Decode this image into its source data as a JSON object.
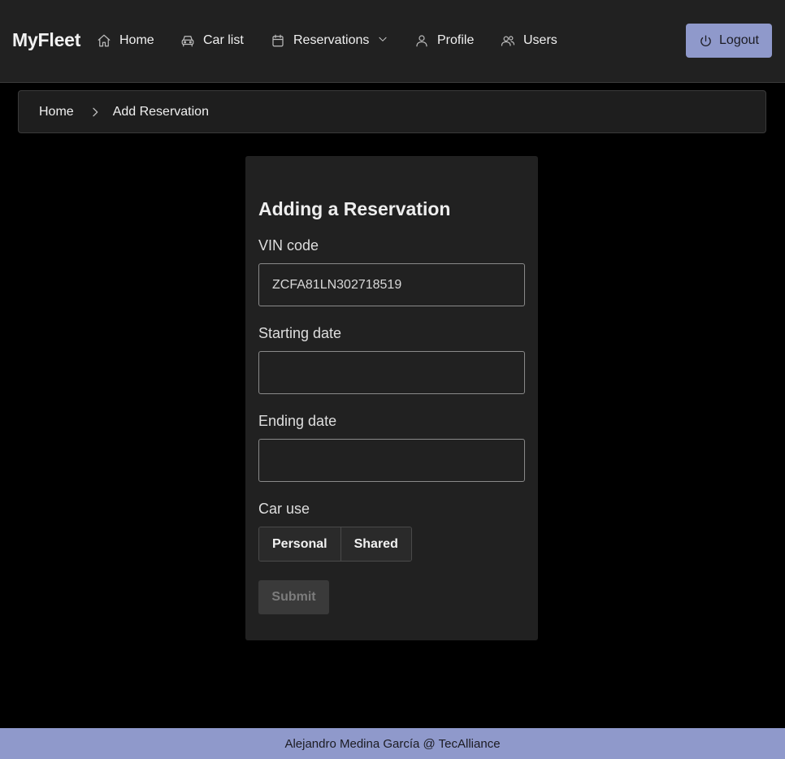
{
  "app": {
    "brand": "MyFleet"
  },
  "nav": {
    "items": [
      {
        "label": "Home",
        "icon": "home-icon"
      },
      {
        "label": "Car list",
        "icon": "car-icon"
      },
      {
        "label": "Reservations",
        "icon": "calendar-icon"
      },
      {
        "label": "Profile",
        "icon": "user-icon"
      },
      {
        "label": "Users",
        "icon": "users-icon"
      }
    ],
    "logout_label": "Logout"
  },
  "breadcrumb": {
    "home": "Home",
    "current": "Add Reservation"
  },
  "form": {
    "title": "Adding a Reservation",
    "vin_label": "VIN code",
    "vin_value": "ZCFA81LN302718519",
    "start_label": "Starting date",
    "start_value": "",
    "end_label": "Ending date",
    "end_value": "",
    "car_use_label": "Car use",
    "car_use_options": [
      "Personal",
      "Shared"
    ],
    "submit_label": "Submit"
  },
  "footer": {
    "text": "Alejandro Medina García @ TecAlliance"
  },
  "colors": {
    "accent": "#8f99cb",
    "surface": "#212121",
    "background": "#000000"
  }
}
